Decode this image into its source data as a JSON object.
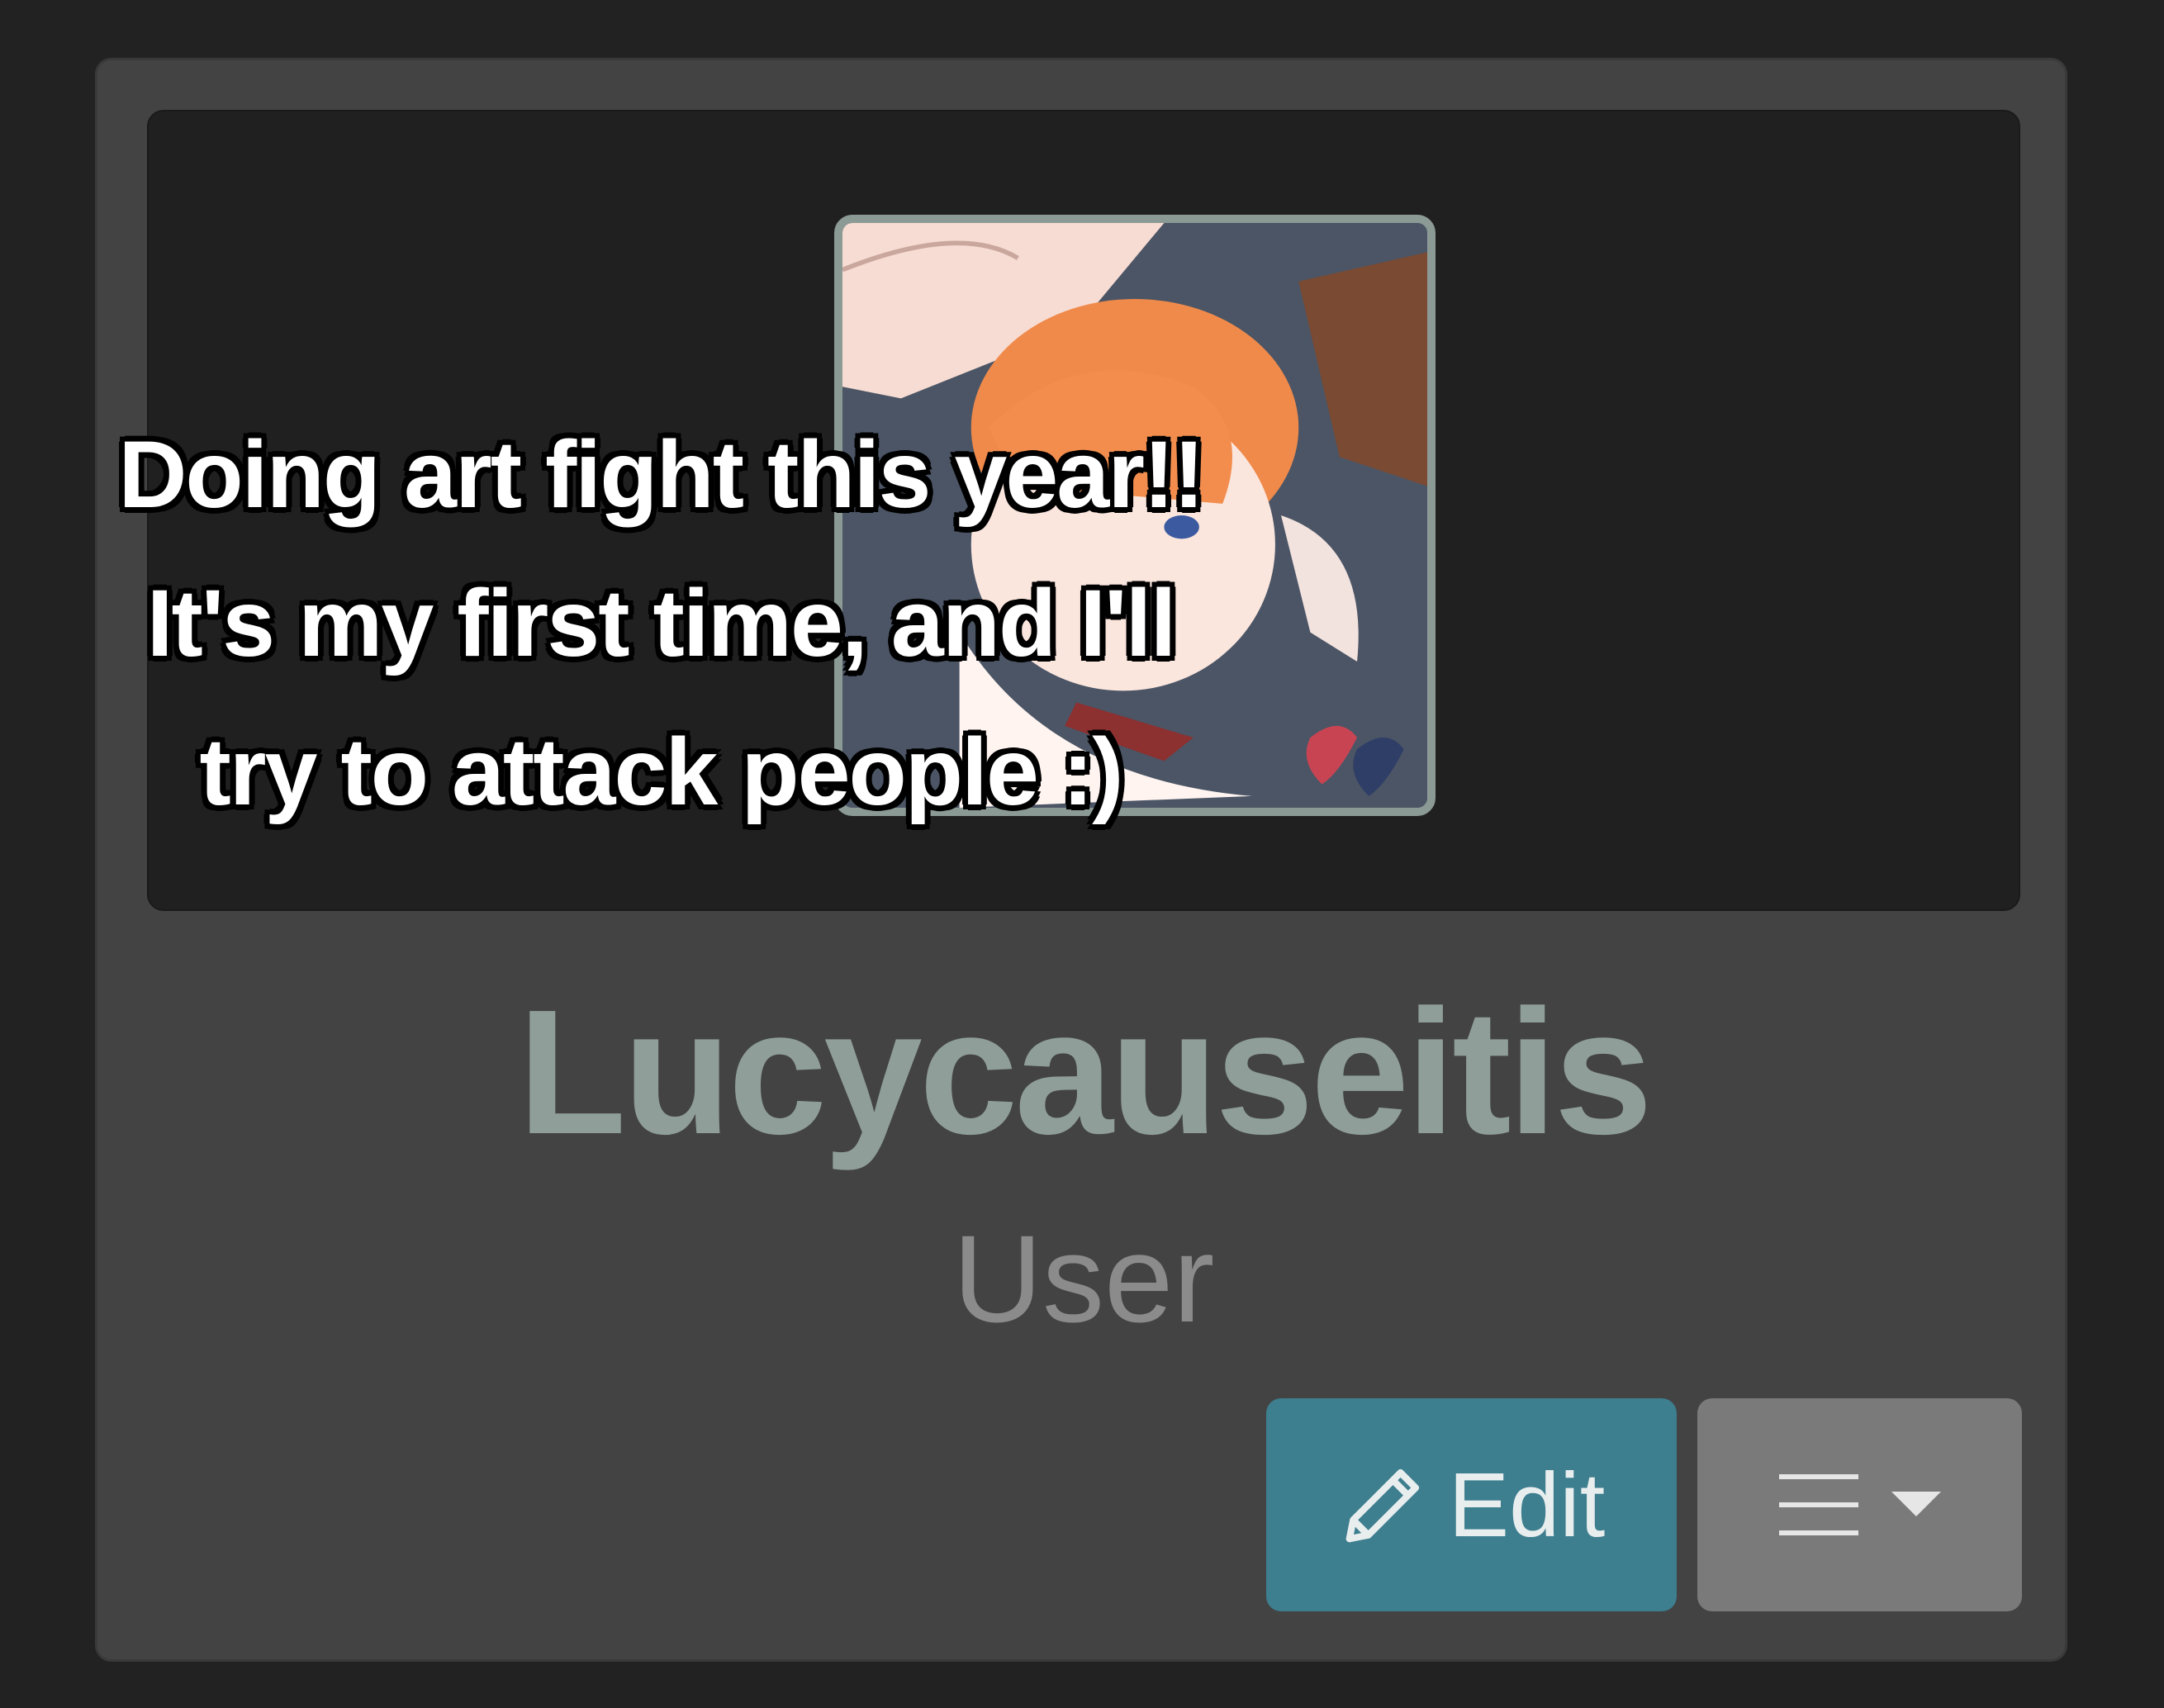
{
  "overlay_caption": {
    "lines": [
      "Doing art fight this year!!",
      "It's my first time, and I'll",
      "try to attack people :)"
    ]
  },
  "profile": {
    "username": "Lucycauseitis",
    "role": "User",
    "avatar_icon": "avatar-illustration"
  },
  "actions": {
    "edit_label": "Edit",
    "edit_icon": "pencil-icon",
    "menu_icon": "hamburger-icon",
    "menu_caret": "caret-down-icon"
  },
  "colors": {
    "background": "#222222",
    "card": "#434343",
    "banner": "#202020",
    "username": "#8f9e99",
    "role": "#8b8b8b",
    "edit_button": "#3d7e8f",
    "menu_button": "#7a7a7a"
  }
}
